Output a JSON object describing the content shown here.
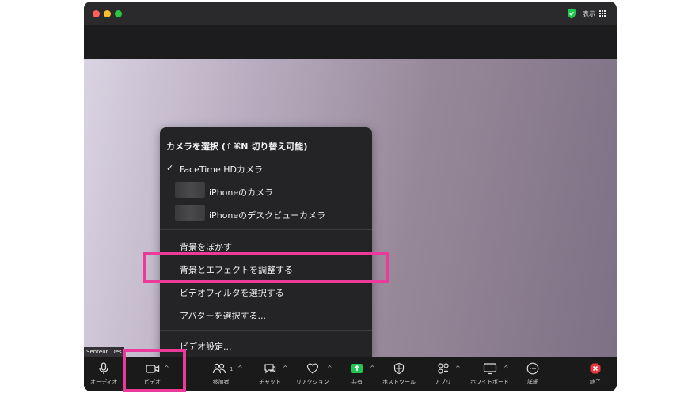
{
  "titlebar": {
    "view_label": "表示"
  },
  "participant": {
    "name": "Senteur. Des"
  },
  "menu": {
    "header": "カメラを選択 (⇧⌘N 切り替え可能)",
    "cameras": [
      {
        "label": "FaceTime HDカメラ",
        "checked": true
      },
      {
        "label": "iPhoneのカメラ",
        "checked": false
      },
      {
        "label": "iPhoneのデスクビューカメラ",
        "checked": false
      }
    ],
    "check_mark": "✓",
    "items": [
      {
        "label": "背景をぼかす"
      },
      {
        "label": "背景とエフェクトを調整する"
      },
      {
        "label": "ビデオフィルタを選択する"
      },
      {
        "label": "アバターを選択する..."
      },
      {
        "label": "ビデオ設定..."
      }
    ]
  },
  "toolbar": {
    "audio": "オーディオ",
    "video": "ビデオ",
    "participants": "参加者",
    "participants_count": "1",
    "chat": "チャット",
    "reactions": "リアクション",
    "share": "共有",
    "host_tools": "ホストツール",
    "apps": "アプリ",
    "whiteboard": "ホワイトボード",
    "details": "詳細",
    "end": "終了",
    "caret": "^"
  },
  "colors": {
    "highlight": "#ec3a9a",
    "share_green": "#23c552",
    "end_red": "#e8363d"
  }
}
